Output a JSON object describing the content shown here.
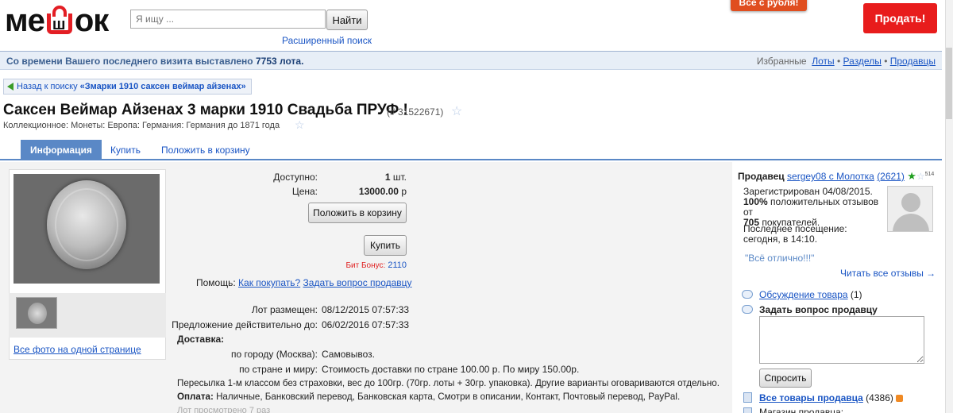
{
  "header": {
    "logo_text_1": "ме",
    "logo_bag_letter": "ш",
    "logo_text_2": "ок",
    "search_placeholder": "Я ищу ...",
    "search_button": "Найти",
    "advanced_search": "Расширенный поиск",
    "promo": "Всё с рубля!",
    "sell_button": "Продать!"
  },
  "infobar": {
    "message_prefix": "Со времени Вашего последнего визита выставлено",
    "message_count": "7753",
    "message_suffix": "лота.",
    "favorites_label": "Избранные",
    "favorites_links": [
      "Лоты",
      "Разделы",
      "Продавцы"
    ],
    "separator": "•"
  },
  "back": {
    "label": "Назад к поиску",
    "query": "«Змарки 1910 саксен веймар айзенах»"
  },
  "lot": {
    "title": "Саксен Веймар Айзенах 3 марки 1910 Свадьба ПРУФ !",
    "number": "(# 31522671)",
    "category": "Коллекционное: Монеты: Европа: Германия: Германия до 1871 года"
  },
  "tabs": [
    "Информация",
    "Купить",
    "Положить в корзину"
  ],
  "photos": {
    "all_photos_link": "Все фото на одной странице"
  },
  "details": {
    "available_label": "Доступно:",
    "available_value": "1",
    "available_unit": "шт.",
    "price_label": "Цена:",
    "price_value": "13000.00",
    "price_unit": "р",
    "cart_button": "Положить в корзину",
    "buy_button": "Купить",
    "bonus_label": "Бит Бонус:",
    "bonus_value": "2110",
    "help_label": "Помощь:",
    "help_links": [
      "Как покупать?",
      "Задать вопрос продавцу"
    ],
    "posted_label": "Лот размещен:",
    "posted_value": "08/12/2015 07:57:33",
    "valid_label": "Предложение действительно до:",
    "valid_value": "06/02/2016 07:57:33",
    "delivery_label": "Доставка:",
    "city_label": "по городу (Москва):",
    "city_value": "Самовывоз.",
    "country_label": "по стране и миру:",
    "country_value": "Стоимость доставки по стране 100.00 р. По миру 150.00р.",
    "shipping_note": "Пересылка 1-м классом без страховки, вес до 100гр. (70гр. лоты + 30гр. упаковка). Другие варианты оговариваются отдельно.",
    "payment_label": "Оплата:",
    "payment_value": "Наличные, Банковский перевод, Банковская карта, Смотри в описании, Контакт, Почтовый перевод, PayPal.",
    "views": "Лот просмотрено 7 раз"
  },
  "seller": {
    "label": "Продавец",
    "name": "sergey08 с Молотка",
    "rating": "(2621)",
    "badge": "514",
    "registered": "Зарегистрирован 04/08/2015.",
    "positive_pct": "100%",
    "positive_text": "положительных отзывов от",
    "buyers_count": "705",
    "buyers_text": "покупателей.",
    "last_visit": "Последнее посещение: сегодня, в 14:10.",
    "quote": "\"Всё отлично!!!\"",
    "read_all": "Читать все отзывы →",
    "discussion_link": "Обсуждение товара",
    "discussion_count": "(1)",
    "ask_title": "Задать вопрос продавцу",
    "ask_button": "Спросить",
    "all_items_link": "Все товары продавца",
    "all_items_count": "(4386)",
    "shop_label": "Магазин продавца:"
  },
  "colors": {
    "brand_red": "#e31e24",
    "tab_blue": "#5a88c6",
    "link_blue": "#1a55c4",
    "star_green": "#22a022"
  }
}
